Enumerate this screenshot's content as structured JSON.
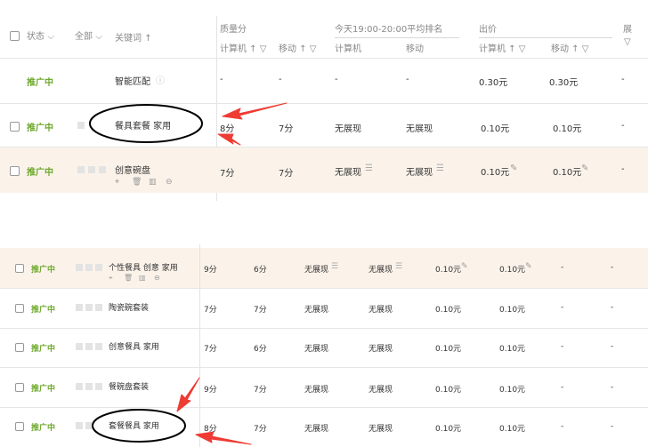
{
  "panel1": {
    "header": {
      "status": "状态",
      "all": "全部",
      "keyword": "关键词",
      "quality_group": "质量分",
      "ranking_group": "今天19:00-20:00平均排名",
      "bid_group": "出价",
      "display_group": "展",
      "computer_sort": "计算机",
      "mobile_sort": "移动",
      "computer": "计算机",
      "mobile": "移动"
    },
    "rows": [
      {
        "status": "推广中",
        "keyword": "智能匹配",
        "quality_pc": "-",
        "quality_mobile": "-",
        "rank_pc": "-",
        "rank_mobile": "-",
        "bid_pc": "0.30元",
        "bid_mobile": "0.30元",
        "extra": "-"
      },
      {
        "status": "推广中",
        "keyword": "餐具套餐 家用",
        "quality_pc": "8分",
        "quality_mobile": "7分",
        "rank_pc": "无展现",
        "rank_mobile": "无展现",
        "bid_pc": "0.10元",
        "bid_mobile": "0.10元",
        "extra": "-"
      },
      {
        "status": "推广中",
        "keyword": "创意碗盘",
        "quality_pc": "7分",
        "quality_mobile": "7分",
        "rank_pc": "无展现",
        "rank_mobile": "无展现",
        "bid_pc": "0.10元",
        "bid_mobile": "0.10元",
        "extra": "-"
      }
    ]
  },
  "panel2": {
    "rows": [
      {
        "status": "推广中",
        "keyword": "个性餐具 创意 家用",
        "quality_pc": "9分",
        "quality_mobile": "6分",
        "rank_pc": "无展现",
        "rank_mobile": "无展现",
        "bid_pc": "0.10元",
        "bid_mobile": "0.10元",
        "extra1": "-",
        "extra2": "-"
      },
      {
        "status": "推广中",
        "keyword": "陶瓷碗套装",
        "quality_pc": "7分",
        "quality_mobile": "7分",
        "rank_pc": "无展现",
        "rank_mobile": "无展现",
        "bid_pc": "0.10元",
        "bid_mobile": "0.10元",
        "extra1": "-",
        "extra2": "-"
      },
      {
        "status": "推广中",
        "keyword": "创意餐具 家用",
        "quality_pc": "7分",
        "quality_mobile": "6分",
        "rank_pc": "无展现",
        "rank_mobile": "无展现",
        "bid_pc": "0.10元",
        "bid_mobile": "0.10元",
        "extra1": "-",
        "extra2": "-"
      },
      {
        "status": "推广中",
        "keyword": "餐碗盘套装",
        "quality_pc": "9分",
        "quality_mobile": "7分",
        "rank_pc": "无展现",
        "rank_mobile": "无展现",
        "bid_pc": "0.10元",
        "bid_mobile": "0.10元",
        "extra1": "-",
        "extra2": "-"
      },
      {
        "status": "推广中",
        "keyword": "套餐餐具 家用",
        "quality_pc": "8分",
        "quality_mobile": "7分",
        "rank_pc": "无展现",
        "rank_mobile": "无展现",
        "bid_pc": "0.10元",
        "bid_mobile": "0.10元",
        "extra1": "-",
        "extra2": "-"
      }
    ]
  },
  "colors": {
    "status": "#6ea82d",
    "highlight_row": "#fbf3ea",
    "arrow": "#ee3b33"
  }
}
